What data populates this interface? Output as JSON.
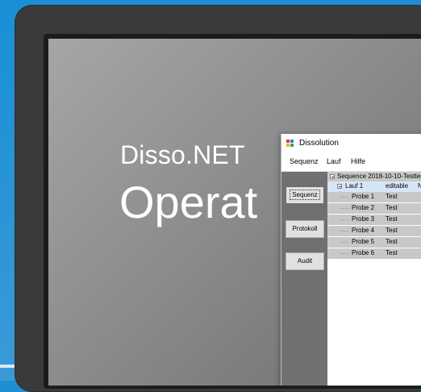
{
  "brand": {
    "line1": "Disso.NET",
    "line2": "Operat"
  },
  "window": {
    "title": "Dissolution"
  },
  "menu": [
    "Sequenz",
    "Lauf",
    "Hilfe"
  ],
  "side_buttons": [
    {
      "label": "Sequenz"
    },
    {
      "label": "Protokoll"
    },
    {
      "label": "Audit"
    }
  ],
  "tree": {
    "root": "Sequence 2018-10-10-Testtes",
    "run": {
      "name": "Lauf 1",
      "status": "editable",
      "extra": "N"
    },
    "samples": [
      {
        "name": "Probe 1",
        "type": "Test"
      },
      {
        "name": "Probe 2",
        "type": "Test"
      },
      {
        "name": "Probe 3",
        "type": "Test"
      },
      {
        "name": "Probe 4",
        "type": "Test"
      },
      {
        "name": "Probe 5",
        "type": "Test"
      },
      {
        "name": "Probe 6",
        "type": "Test"
      }
    ]
  }
}
